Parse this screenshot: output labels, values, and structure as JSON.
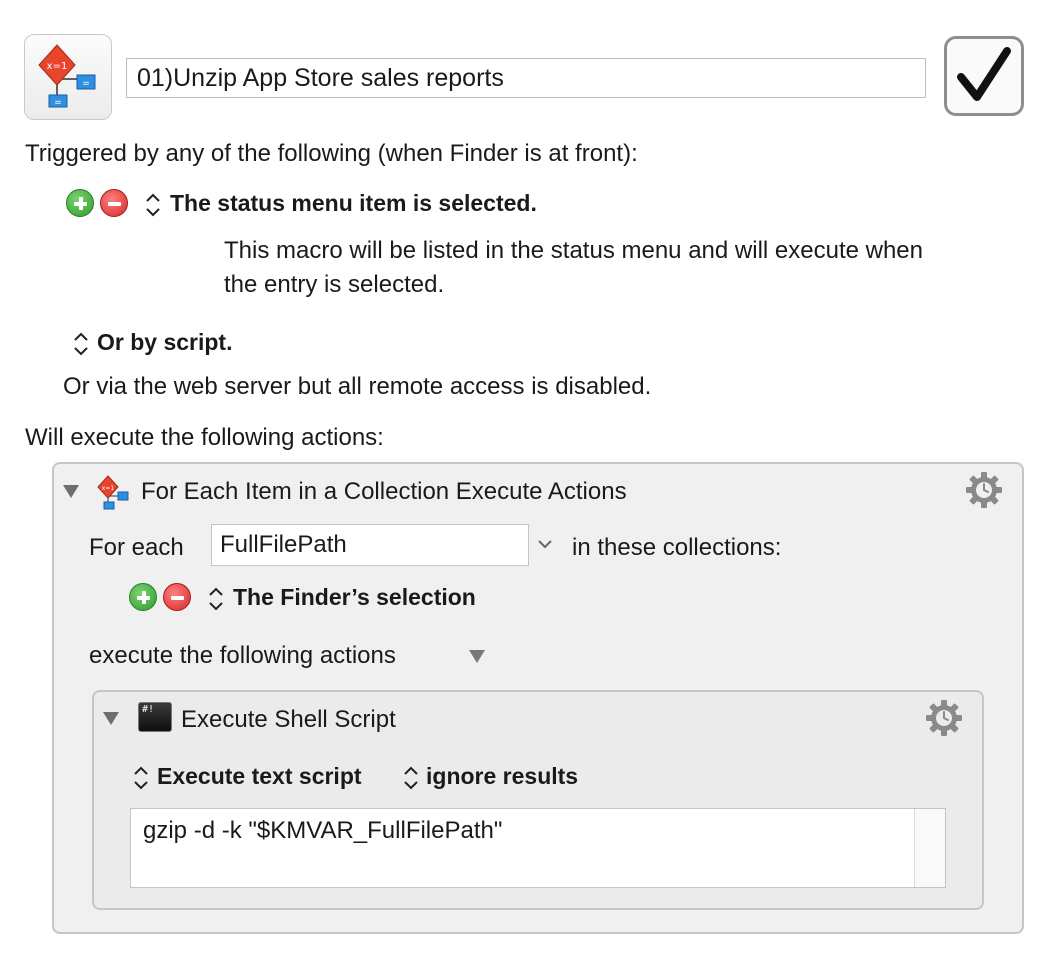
{
  "macro": {
    "name": "01)Unzip App Store sales reports",
    "enabled": true,
    "icon": "flowchart-variable-icon"
  },
  "trigger_section": {
    "header": "Triggered by any of the following (when Finder is at front):",
    "status_trigger": {
      "label": "The status menu item is selected.",
      "description_line1": "This macro will be listed in the status menu and will execute when",
      "description_line2": "the entry is selected."
    },
    "script_trigger": "Or by script.",
    "web_server_note": "Or via the web server but all remote access is disabled."
  },
  "actions_header": "Will execute the following actions:",
  "foreach_action": {
    "title": "For Each Item in a Collection Execute Actions",
    "for_each_label": "For each",
    "variable": "FullFilePath",
    "collections_label": "in these collections:",
    "collection": "The Finder’s selection",
    "execute_label": "execute the following actions"
  },
  "shell_action": {
    "title": "Execute Shell Script",
    "icon_text": "#!",
    "mode": "Execute text script",
    "results": "ignore results",
    "script": "gzip -d -k \"$KMVAR_FullFilePath\""
  },
  "colors": {
    "add_green": "#2f9a2f",
    "remove_red": "#d42a2a",
    "action_bg": "#f0f0f0",
    "gear_gray": "#8a8a8a"
  }
}
